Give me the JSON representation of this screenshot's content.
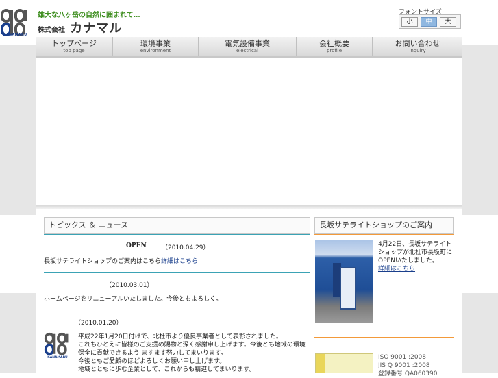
{
  "brand": {
    "logo_text": "KANAMARU",
    "tagline": "雄大な八ヶ岳の自然に囲まれて…",
    "company_prefix": "株式会社",
    "company_name": "カナマル"
  },
  "font_size": {
    "label": "フォントサイズ",
    "options": [
      "小",
      "中",
      "大"
    ],
    "selected": "中"
  },
  "nav": {
    "items": [
      {
        "jp": "トップページ",
        "en": "top page"
      },
      {
        "jp": "環境事業",
        "en": "environment"
      },
      {
        "jp": "電気設備事業",
        "en": "electrical"
      },
      {
        "jp": "会社概要",
        "en": "profile"
      },
      {
        "jp": "お問い合わせ",
        "en": "inquiry"
      }
    ]
  },
  "topics": {
    "heading": "トピックス ＆ ニュース",
    "news": [
      {
        "title": "OPEN",
        "date": "（2010.04.29）",
        "body": "長坂サテライトショップのご案内はこちら",
        "link": "詳細はこちら"
      },
      {
        "title": "",
        "date": "（2010.03.01）",
        "body": "ホームページをリニューアルいたしました。今後ともよろしく。"
      },
      {
        "title": "",
        "date": "（2010.01.20）",
        "lines": [
          "平成22年1月20日付けで、北杜市より優良事業者として表彰されました。",
          "これもひとえに皆様のご支援の賜物と深く感謝申し上げます。今後とも地域の環境保全に貢献できるよう ますます努力してまいります。",
          "今後ともご愛顧のほどよろしくお願い申し上げます。",
          "地域とともに歩む企業として、これからも精進してまいります。"
        ]
      }
    ]
  },
  "shop": {
    "heading": "長坂サテライトショップのご案内",
    "text": "4月22日、長坂サテライトショップが北杜市長坂町にOPENいたしました。",
    "link": "詳細はこちら"
  },
  "cert": {
    "lines": [
      "ISO 9001 :2008",
      "JIS Q 9001 :2008",
      "登録番号 QA060390"
    ]
  },
  "colors": {
    "accent_teal": "#3ba3b5",
    "accent_orange": "#f39a3a",
    "brand_blue": "#1a3f8c",
    "tagline_green": "#3e8e1f"
  }
}
